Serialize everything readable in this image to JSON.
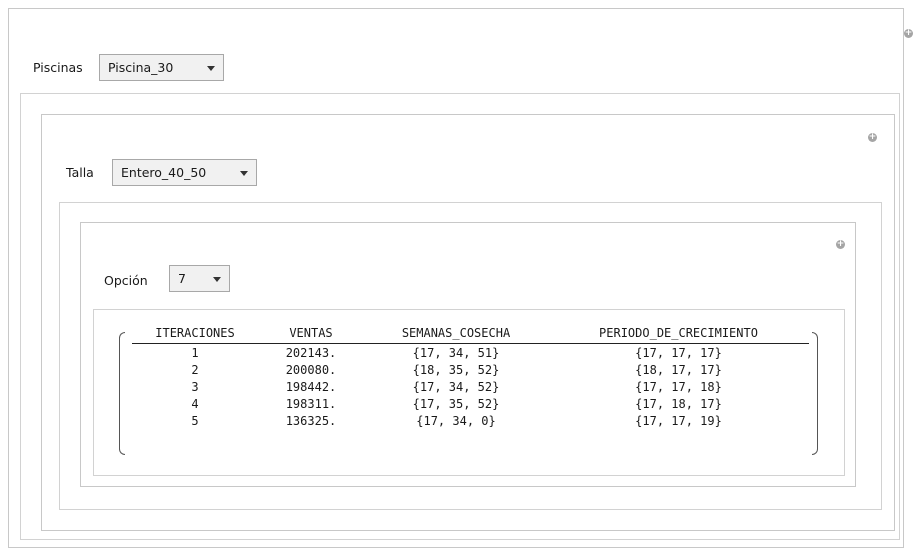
{
  "piscinas": {
    "label": "Piscinas",
    "selected": "Piscina_30"
  },
  "talla": {
    "label": "Talla",
    "selected": "Entero_40_50"
  },
  "opcion": {
    "label": "Opción",
    "selected": "7"
  },
  "add_glyph": "+",
  "results": {
    "headers": [
      "ITERACIONES",
      "VENTAS",
      "SEMANAS_COSECHA",
      "PERIODO_DE_CRECIMIENTO"
    ],
    "rows": [
      [
        "1",
        "202143.",
        "{17, 34, 51}",
        "{17, 17, 17}"
      ],
      [
        "2",
        "200080.",
        "{18, 35, 52}",
        "{18, 17, 17}"
      ],
      [
        "3",
        "198442.",
        "{17, 34, 52}",
        "{17, 17, 18}"
      ],
      [
        "4",
        "198311.",
        "{17, 35, 52}",
        "{17, 18, 17}"
      ],
      [
        "5",
        "136325.",
        "{17, 34, 0}",
        "{17, 17, 19}"
      ]
    ]
  }
}
